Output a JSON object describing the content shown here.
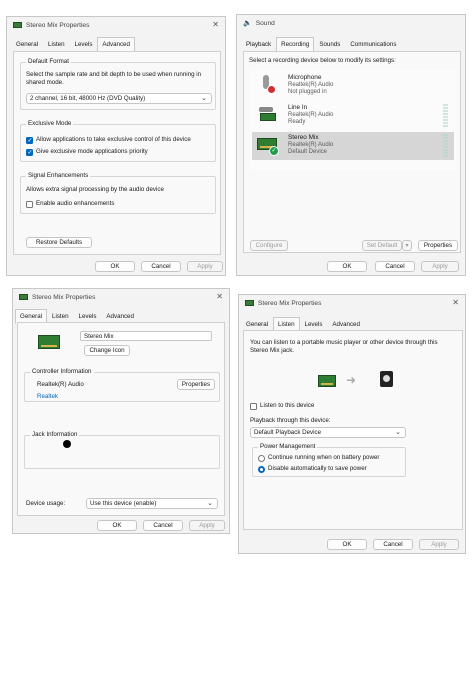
{
  "win1": {
    "title": "Stereo Mix Properties",
    "tabs": [
      "General",
      "Listen",
      "Levels",
      "Advanced"
    ],
    "default_format": {
      "group": "Default Format",
      "desc": "Select the sample rate and bit depth to be used when running in shared mode.",
      "value": "2 channel, 16 bit, 48000 Hz (DVD Quality)"
    },
    "exclusive": {
      "group": "Exclusive Mode",
      "opt1": "Allow applications to take exclusive control of this device",
      "opt2": "Give exclusive mode applications priority"
    },
    "signal": {
      "group": "Signal Enhancements",
      "desc": "Allows extra signal processing by the audio device",
      "opt": "Enable audio enhancements"
    },
    "restore": "Restore Defaults",
    "ok": "OK",
    "cancel": "Cancel",
    "apply": "Apply"
  },
  "win2": {
    "title": "Sound",
    "tabs": [
      "Playback",
      "Recording",
      "Sounds",
      "Communications"
    ],
    "instruction": "Select a recording device below to modify its settings:",
    "devices": [
      {
        "name": "Microphone",
        "driver": "Realtek(R) Audio",
        "status": "Not plugged in",
        "icon": "microphone-icon"
      },
      {
        "name": "Line In",
        "driver": "Realtek(R) Audio",
        "status": "Ready",
        "icon": "line-in-icon"
      },
      {
        "name": "Stereo Mix",
        "driver": "Realtek(R) Audio",
        "status": "Default Device",
        "icon": "sound-card-icon"
      }
    ],
    "configure": "Configure",
    "set_default": "Set Default",
    "properties": "Properties",
    "ok": "OK",
    "cancel": "Cancel",
    "apply": "Apply"
  },
  "win3": {
    "title": "Stereo Mix Properties",
    "tabs": [
      "General",
      "Listen",
      "Levels",
      "Advanced"
    ],
    "device_name": "Stereo Mix",
    "change_icon": "Change Icon",
    "controller": {
      "group": "Controller Information",
      "name": "Realtek(R) Audio",
      "properties": "Properties",
      "vendor": "Realtek"
    },
    "jack": {
      "group": "Jack Information"
    },
    "usage_label": "Device usage:",
    "usage_value": "Use this device (enable)",
    "ok": "OK",
    "cancel": "Cancel",
    "apply": "Apply"
  },
  "win4": {
    "title": "Stereo Mix Properties",
    "tabs": [
      "General",
      "Listen",
      "Levels",
      "Advanced"
    ],
    "desc": "You can listen to a portable music player or other device through this Stereo Mix jack.",
    "listen_label": "Listen to this device",
    "playback_label": "Playback through this device:",
    "playback_value": "Default Playback Device",
    "power": {
      "group": "Power Management",
      "opt1": "Continue running when on battery power",
      "opt2": "Disable automatically to save power"
    },
    "ok": "OK",
    "cancel": "Cancel",
    "apply": "Apply"
  },
  "colors": {
    "accent": "#0067c0",
    "selected_row": "#d6d6d6",
    "board": "#2e7d32"
  }
}
